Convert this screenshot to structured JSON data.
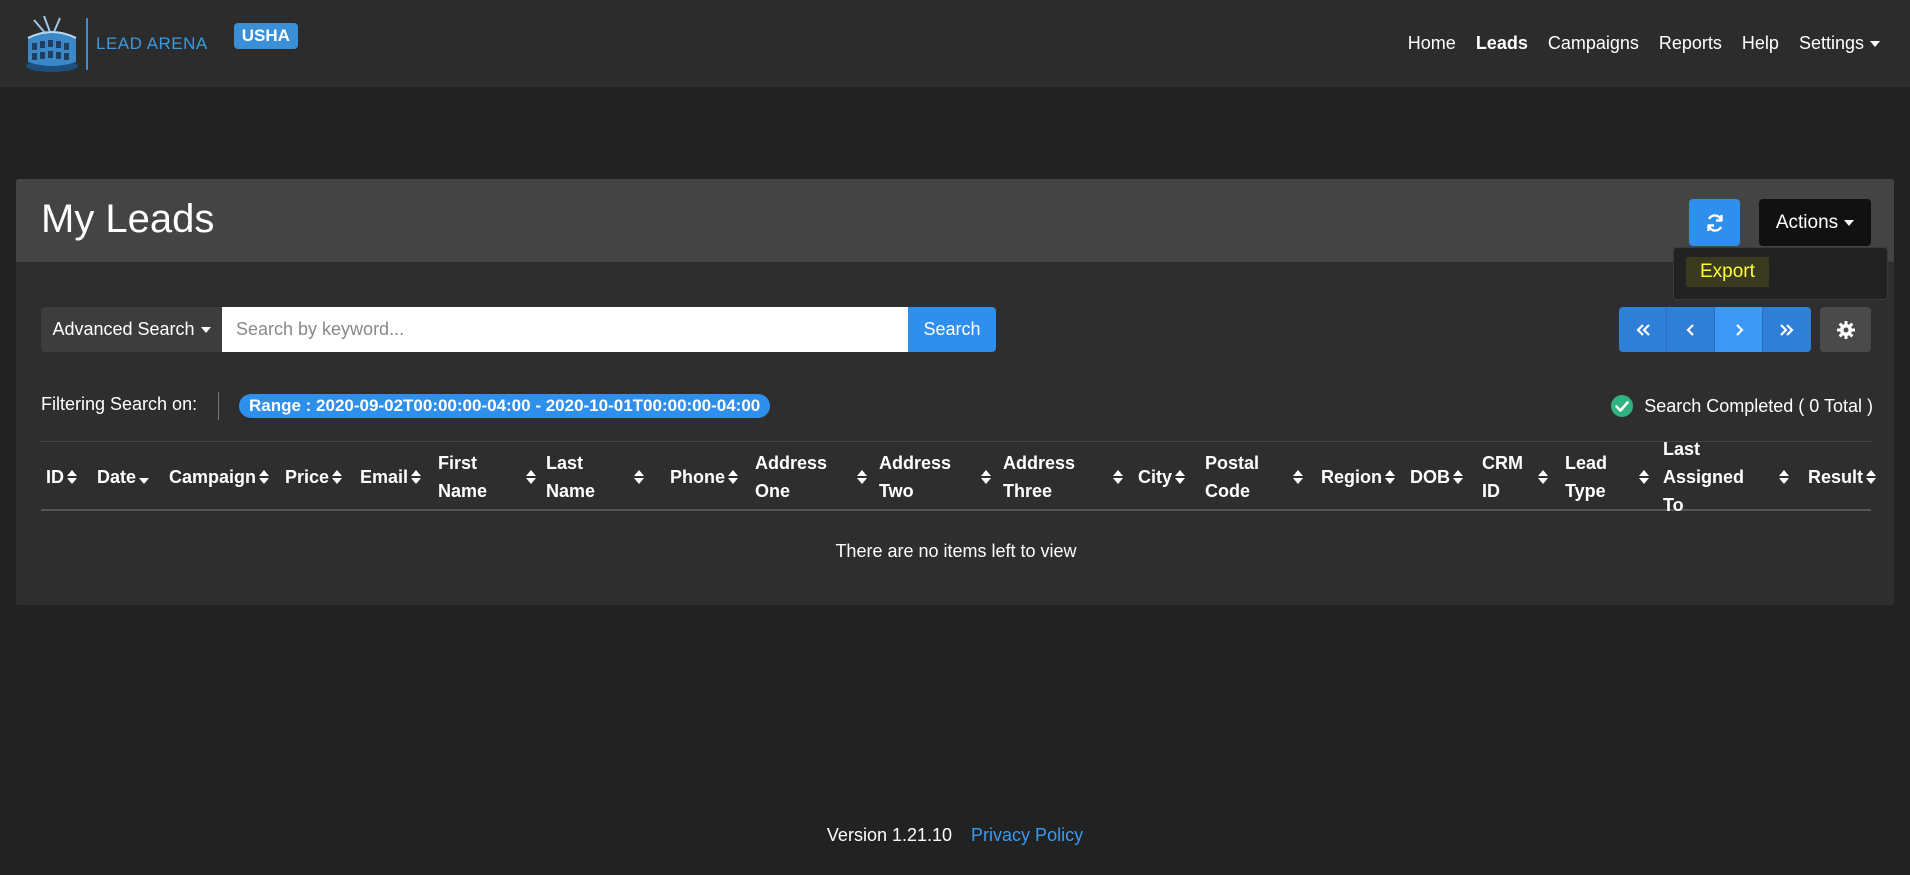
{
  "navbar": {
    "brand_text": "LEAD ARENA",
    "tenant_badge": "USHA",
    "links": [
      {
        "label": "Home"
      },
      {
        "label": "Leads"
      },
      {
        "label": "Campaigns"
      },
      {
        "label": "Reports"
      },
      {
        "label": "Help"
      },
      {
        "label": "Settings"
      }
    ],
    "active_link": "Leads"
  },
  "page": {
    "title": "My Leads",
    "actions_label": "Actions",
    "dropdown": {
      "export_label": "Export"
    }
  },
  "search": {
    "advanced_label": "Advanced Search",
    "placeholder": "Search by keyword...",
    "value": "",
    "button_label": "Search"
  },
  "filter": {
    "label": "Filtering Search on:",
    "pill": "Range : 2020-09-02T00:00:00-04:00 - 2020-10-01T00:00:00-04:00",
    "status": "Search Completed ( 0 Total )"
  },
  "table": {
    "columns": [
      {
        "label": "ID",
        "sort": "both"
      },
      {
        "label": "Date",
        "sort": "desc"
      },
      {
        "label": "Campaign",
        "sort": "both"
      },
      {
        "label": "Price",
        "sort": "both"
      },
      {
        "label": "Email",
        "sort": "both"
      },
      {
        "label": "First\nName",
        "sort": "both"
      },
      {
        "label": "Last\nName",
        "sort": "both"
      },
      {
        "label": "Phone",
        "sort": "both"
      },
      {
        "label": "Address\nOne",
        "sort": "both"
      },
      {
        "label": "Address\nTwo",
        "sort": "both"
      },
      {
        "label": "Address\nThree",
        "sort": "both"
      },
      {
        "label": "City",
        "sort": "both"
      },
      {
        "label": "Postal\nCode",
        "sort": "both"
      },
      {
        "label": "Region",
        "sort": "both"
      },
      {
        "label": "DOB",
        "sort": "both"
      },
      {
        "label": "CRM\nID",
        "sort": "both"
      },
      {
        "label": "Lead\nType",
        "sort": "both"
      },
      {
        "label": "Last Assigned\nTo",
        "sort": "both"
      },
      {
        "label": "Result",
        "sort": "both"
      }
    ],
    "rows": [],
    "empty_message": "There are no items left to view"
  },
  "footer": {
    "version": "Version 1.21.10",
    "privacy_label": "Privacy Policy"
  },
  "colors": {
    "primary": "#2f8fed",
    "navbar_bg": "#2c2c2c",
    "page_bg": "#222222",
    "export_highlight": "#ffff33"
  }
}
